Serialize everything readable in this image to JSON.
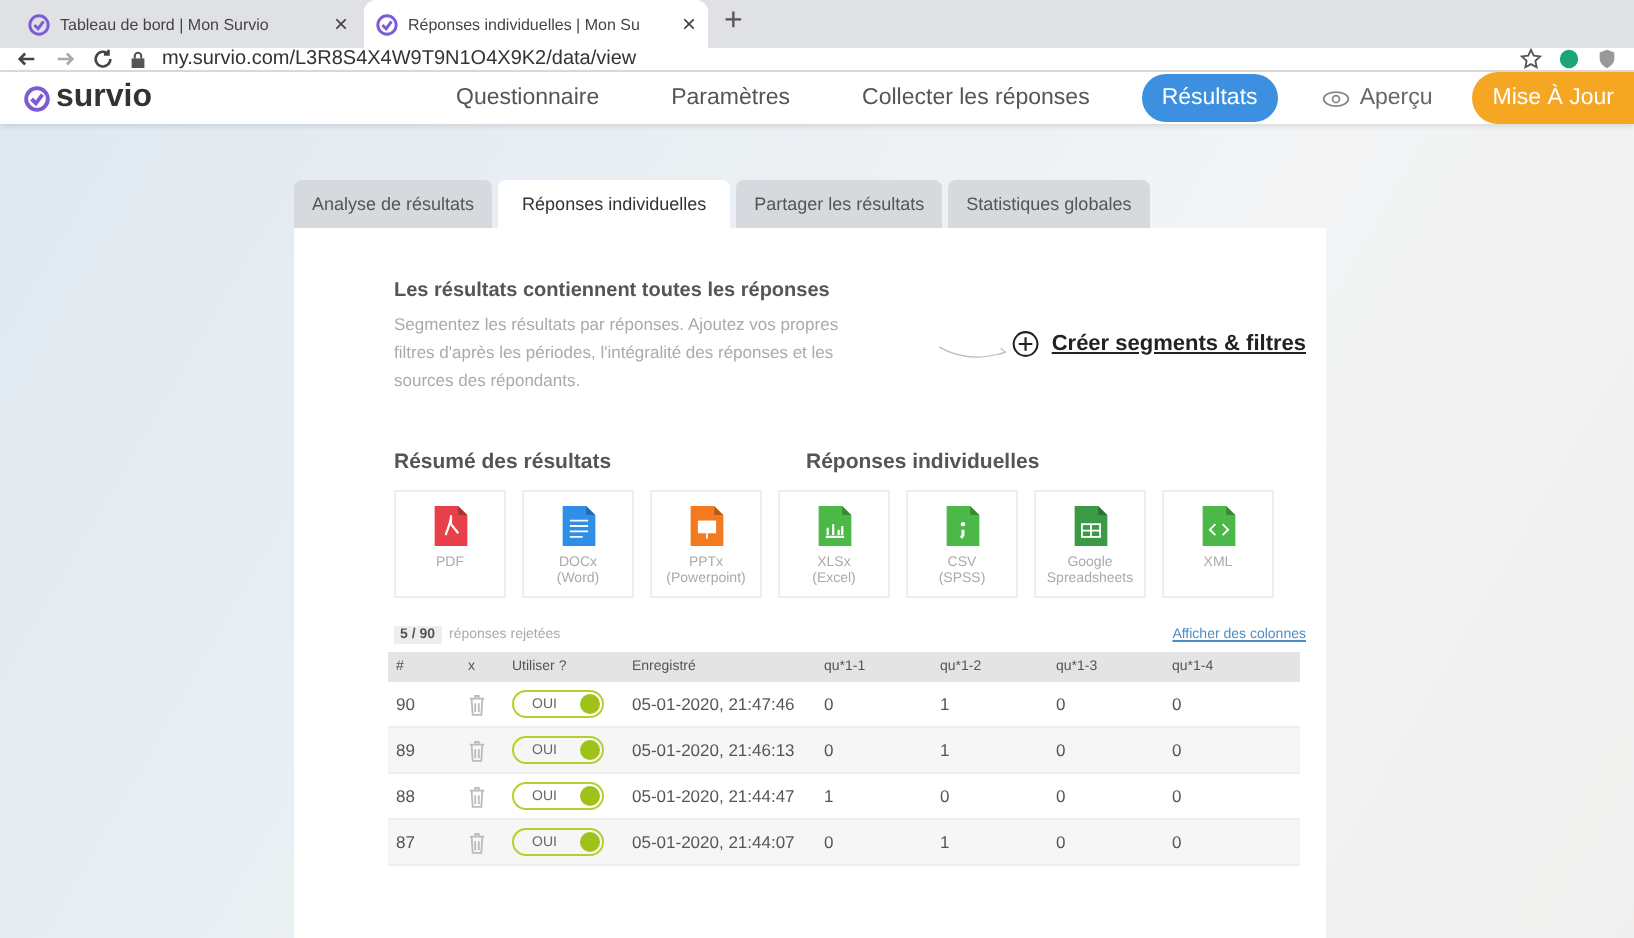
{
  "browser": {
    "tabs": [
      {
        "title": "Tableau de bord | Mon Survio",
        "selected": false
      },
      {
        "title": "Réponses individuelles | Mon Su",
        "selected": true
      }
    ],
    "new_tab": "+",
    "close": "×",
    "url": "my.survio.com/L3R8S4X4W9T9N1O4X9K2/data/view"
  },
  "app": {
    "logo": "survio",
    "nav": [
      {
        "label": "Questionnaire",
        "selected": false
      },
      {
        "label": "Paramètres",
        "selected": false
      },
      {
        "label": "Collecter les réponses",
        "selected": false
      },
      {
        "label": "Résultats",
        "selected": true
      }
    ],
    "preview": "Aperçu",
    "upgrade": "Mise À Jour"
  },
  "tabs": [
    {
      "label": "Analyse de résultats",
      "selected": false
    },
    {
      "label": "Réponses individuelles",
      "selected": true
    },
    {
      "label": "Partager les résultats",
      "selected": false
    },
    {
      "label": "Statistiques globales",
      "selected": false
    }
  ],
  "intro": {
    "title": "Les résultats contiennent toutes les réponses",
    "text": "Segmentez les résultats par réponses. Ajoutez vos propres filtres d'après les périodes, l'intégralité des réponses et les sources des répondants.",
    "link": "Créer segments & filtres"
  },
  "export_groups": [
    {
      "title": "Résumé des résultats"
    },
    {
      "title": "Réponses individuelles"
    }
  ],
  "exports": [
    {
      "kind": "pdf",
      "label": "PDF",
      "color": "#e8404a"
    },
    {
      "kind": "doc",
      "label": "DOCx\n(Word)",
      "color": "#2f8fe6"
    },
    {
      "kind": "ppt",
      "label": "PPTx\n(Powerpoint)",
      "color": "#f47a20"
    },
    {
      "kind": "xls",
      "label": "XLSx\n(Excel)",
      "color": "#4cb848"
    },
    {
      "kind": "csv",
      "label": "CSV\n(SPSS)",
      "color": "#4cb848"
    },
    {
      "kind": "sheet",
      "label": "Google\nSpreadsheets",
      "color": "#3a9a45"
    },
    {
      "kind": "xml",
      "label": "XML",
      "color": "#4cb848"
    }
  ],
  "rejected": {
    "count": "5 / 90",
    "label": "réponses rejetées"
  },
  "show_columns": "Afficher des colonnes",
  "table": {
    "columns": [
      "#",
      "x",
      "Utiliser ?",
      "Enregistré",
      "qu*1-1",
      "qu*1-2",
      "qu*1-3",
      "qu*1-4"
    ],
    "rows": [
      {
        "number": "90",
        "use": "OUI",
        "on": true,
        "registered": "05-01-2020, 21:47:46",
        "values": [
          "0",
          "1",
          "0",
          "0"
        ]
      },
      {
        "number": "89",
        "use": "OUI",
        "on": true,
        "registered": "05-01-2020, 21:46:13",
        "values": [
          "0",
          "1",
          "0",
          "0"
        ]
      },
      {
        "number": "88",
        "use": "OUI",
        "on": true,
        "registered": "05-01-2020, 21:44:47",
        "values": [
          "1",
          "0",
          "0",
          "0"
        ]
      },
      {
        "number": "87",
        "use": "OUI",
        "on": true,
        "registered": "05-01-2020, 21:44:07",
        "values": [
          "0",
          "1",
          "0",
          "0"
        ]
      }
    ]
  }
}
